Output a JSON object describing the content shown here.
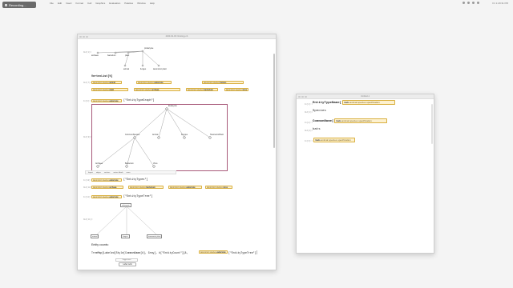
{
  "recording": {
    "label": "Recording..."
  },
  "menubar": {
    "items": [
      "File",
      "Edit",
      "Insert",
      "Format",
      "Cell",
      "Graphics",
      "Evaluation",
      "Palettes",
      "Window",
      "Help"
    ],
    "clock": "Fri 1:29:31 PM"
  },
  "main_window": {
    "title": "2023-02-03 Ontology.nb",
    "cell_labels": [
      "Out[1]=",
      "In[7]:=",
      "Out[7]=",
      "Out[8]=",
      "In[9]:=",
      "Out[9]=",
      "In[10]:=",
      "Out[10]=",
      "In[11]:=",
      "Out[11]="
    ],
    "top_tree": {
      "root": "prokaryote",
      "children": [
        "archaea",
        "bacterium",
        "plant",
        "animal",
        "fungus",
        "taxonomic plant"
      ]
    },
    "vertexlist_code": "VertexList[%]",
    "vertex_chips": [
      [
        "taxonomic species",
        "animal"
      ],
      [
        "taxonomic species",
        "eukaryote"
      ],
      [
        "taxonomic species",
        "fungus"
      ],
      [
        "taxonomic species",
        "plant"
      ],
      [
        "taxonomic species",
        "archaea"
      ],
      [
        "taxonomic species",
        "bacterium"
      ],
      [
        "taxonomic species",
        "virus"
      ]
    ],
    "eukaryote_input": {
      "chip_prefix": "taxonomic species",
      "chip_value": "eukaryote",
      "code": "[\"EntityTypeGraph\"]"
    },
    "graph": {
      "root": "Eukaryote",
      "children": [
        "CommonSpecies",
        "Animal",
        "Fungus",
        "TaxonomicPlant"
      ],
      "grandchildren": [
        "Archaea",
        "Bacterium",
        "Virus"
      ]
    },
    "graph_toolbar": [
      "layout",
      "edges",
      "vertices",
      "vertex labels",
      "more"
    ],
    "in10": {
      "chip_prefix": "taxonomic species",
      "chip_value": "eukaryote",
      "code": "[\"EntityTypes\"]"
    },
    "out10_chips": [
      [
        "taxonomic species",
        "archaea"
      ],
      [
        "taxonomic species",
        "bacterium"
      ],
      [
        "taxonomic species",
        "eukaryote"
      ],
      [
        "taxonomic species",
        "virus"
      ]
    ],
    "in11": {
      "chip_prefix": "taxonomic species",
      "chip_value": "eukaryote",
      "code": "[\"EntityTypeTree\"]"
    },
    "small_tree": {
      "root": "eukaryote",
      "children": [
        "animal",
        "fungus",
        "taxonomic plant"
      ]
    },
    "entity_counts": "Entity counts:",
    "treemap_code": "TreeMap[Labeled[Style[CommonName[#], Gray], #[\"EntityCount\"]]&, ",
    "treemap_chip": [
      "taxonomic species",
      "eukaryote"
    ],
    "treemap_tail": "[\"EntityTypeTree\"]]",
    "popup_text": "Suggestions",
    "bottom_button": "Label cells"
  },
  "side_window": {
    "title": "Untitled-1",
    "cells": [
      {
        "label": "In[1]:=",
        "code": "EntityTypeName[",
        "chip_prefix": "bats",
        "chip_value": "animal species specification"
      },
      {
        "label": "Out[1]=",
        "code": "Species"
      },
      {
        "label": "In[2]:=",
        "code": "CommonName[",
        "chip_prefix": "bats",
        "chip_value": "animal species specification"
      },
      {
        "label": "Out[2]=",
        "code": "bats"
      },
      {
        "label": "In[3]:=",
        "chip_prefix": "bats",
        "chip_value": "animal species specification"
      }
    ]
  }
}
